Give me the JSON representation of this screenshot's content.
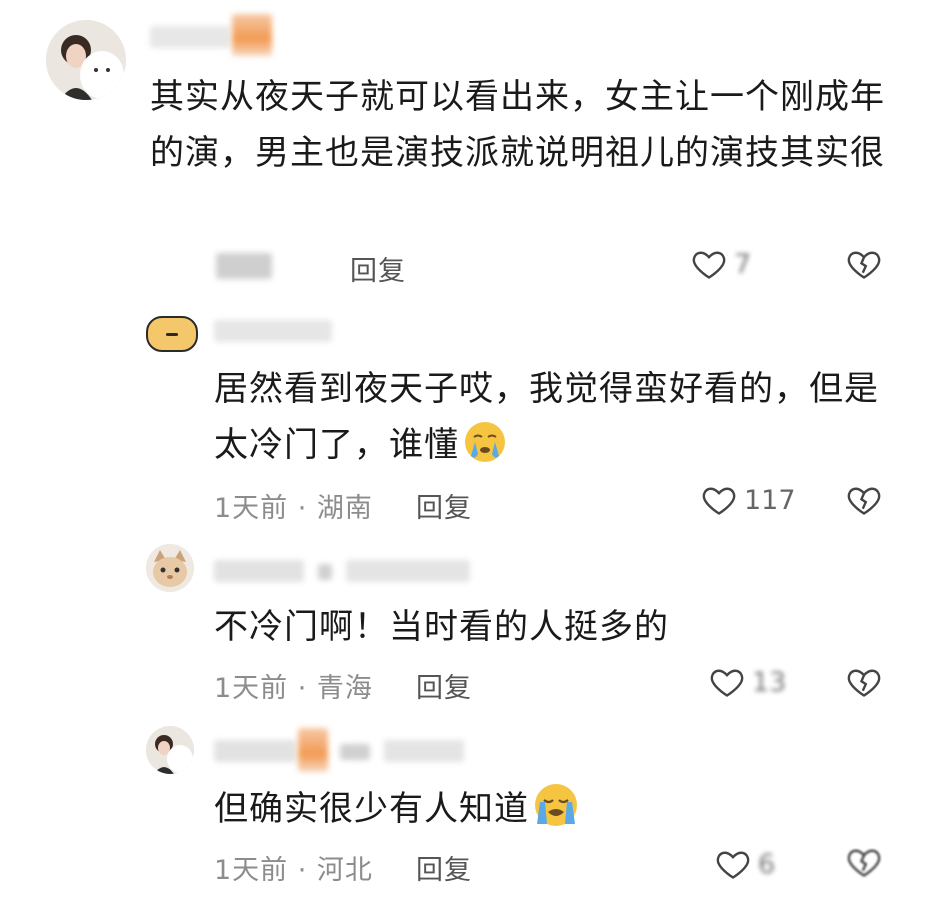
{
  "comments": [
    {
      "text_line1": "其实从夜天子就可以看出来，女主让一个刚成年",
      "text_line2": "的演，男主也是演技派就说明祖儿的演技其实很",
      "reply_label": "回复",
      "like_icon": "heart-outline-icon",
      "dislike_icon": "broken-heart-icon"
    },
    {
      "text_line1": "居然看到夜天子哎，我觉得蛮好看的，但是",
      "text_line2": "太冷门了，谁懂",
      "emoji": "crying-face-emoji",
      "meta": "1天前 · 湖南",
      "reply_label": "回复",
      "like_count": "117"
    },
    {
      "text": "不冷门啊！当时看的人挺多的",
      "meta": "1天前 · 青海",
      "reply_label": "回复"
    },
    {
      "text": "但确实很少有人知道",
      "emoji": "loudly-crying-face-emoji",
      "meta": "1天前 · 河北",
      "reply_label": "回复"
    }
  ],
  "colors": {
    "text": "#1a1a1a",
    "meta": "#8c8c8c",
    "emoji_yellow": "#f5c542",
    "tear_blue": "#5aa9e6"
  }
}
